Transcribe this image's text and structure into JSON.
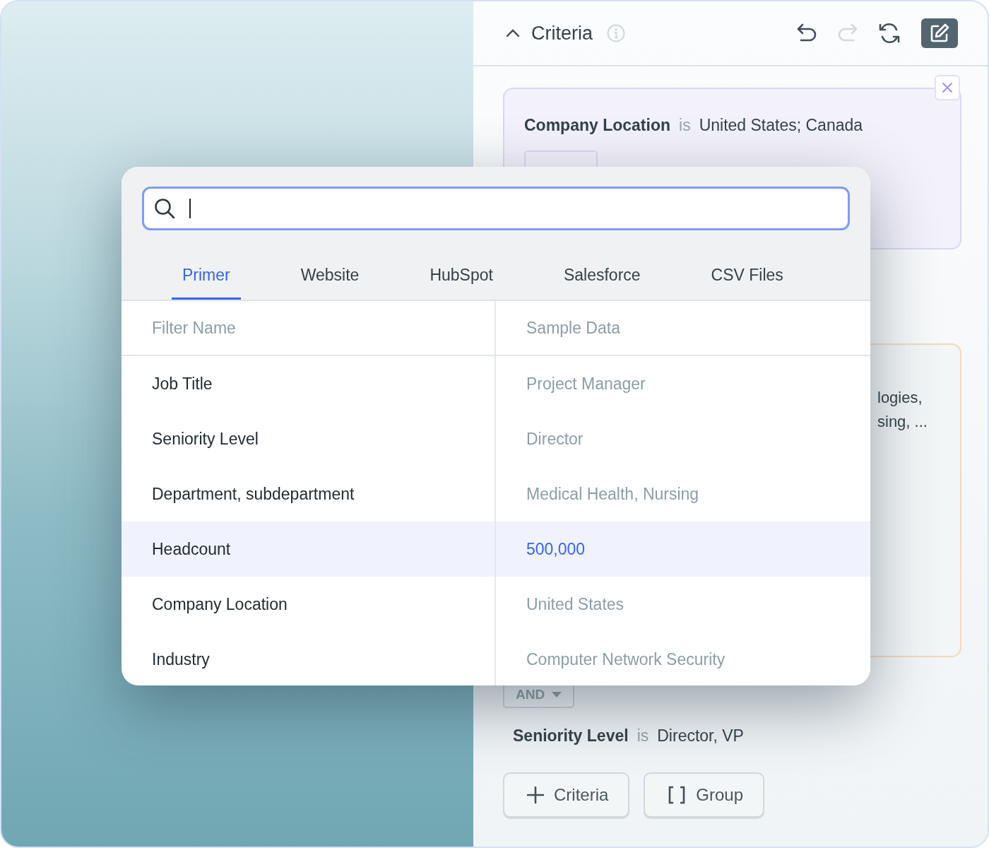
{
  "panel": {
    "title": "Criteria",
    "criteria_cards": [
      {
        "kind": "full",
        "field": "Company Location",
        "operator": "is",
        "value": "United States; Canada"
      },
      {
        "kind": "fragment",
        "lines": [
          "logies,",
          "sing, ..."
        ]
      }
    ],
    "and_chip": {
      "label": "AND"
    },
    "last_criterion": {
      "field": "Seniority Level",
      "operator": "is",
      "value": "Director, VP"
    },
    "buttons": [
      {
        "kind": "plus",
        "label": "Criteria"
      },
      {
        "kind": "brackets",
        "label": "Group"
      }
    ]
  },
  "filter_picker": {
    "tabs": [
      {
        "label": "Primer",
        "selected": true
      },
      {
        "label": "Website",
        "selected": false
      },
      {
        "label": "HubSpot",
        "selected": false
      },
      {
        "label": "Salesforce",
        "selected": false
      },
      {
        "label": "CSV Files",
        "selected": false
      }
    ],
    "columns": [
      "Filter Name",
      "Sample Data"
    ],
    "rows": [
      {
        "name": "Job Title",
        "sample": "Project Manager",
        "selected": false
      },
      {
        "name": "Seniority Level",
        "sample": "Director",
        "selected": false
      },
      {
        "name": "Department, subdepartment",
        "sample": "Medical Health, Nursing",
        "selected": false
      },
      {
        "name": "Headcount",
        "sample": "500,000",
        "selected": true
      },
      {
        "name": "Company Location",
        "sample": "United States",
        "selected": false
      },
      {
        "name": "Industry",
        "sample": "Computer Network Security",
        "selected": false
      }
    ]
  }
}
